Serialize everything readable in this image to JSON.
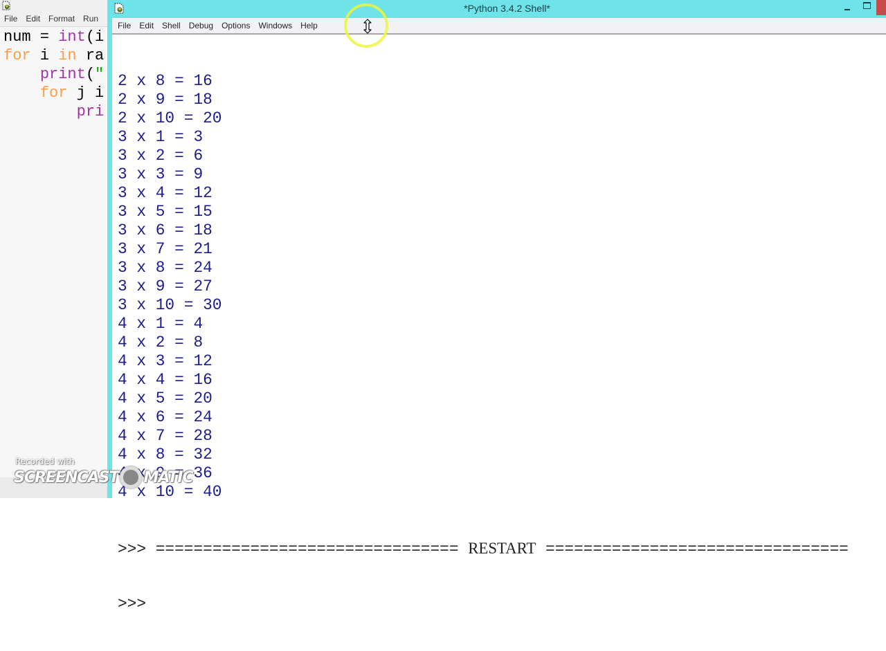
{
  "editor": {
    "menu": [
      "File",
      "Edit",
      "Format",
      "Run"
    ],
    "code_lines": [
      [
        {
          "t": "num = ",
          "c": ""
        },
        {
          "t": "int",
          "c": "bi"
        },
        {
          "t": "(i",
          "c": ""
        }
      ],
      [
        {
          "t": "for",
          "c": "kw"
        },
        {
          "t": " i ",
          "c": ""
        },
        {
          "t": "in",
          "c": "kw"
        },
        {
          "t": " ra",
          "c": ""
        }
      ],
      [
        {
          "t": "    ",
          "c": ""
        },
        {
          "t": "print",
          "c": "bi"
        },
        {
          "t": "(",
          "c": ""
        },
        {
          "t": "\"",
          "c": "str"
        }
      ],
      [
        {
          "t": "    ",
          "c": ""
        },
        {
          "t": "for",
          "c": "kw"
        },
        {
          "t": " j i",
          "c": ""
        }
      ],
      [
        {
          "t": "        ",
          "c": ""
        },
        {
          "t": "pri",
          "c": "bi"
        }
      ]
    ]
  },
  "shell": {
    "title": "*Python 3.4.2 Shell*",
    "menu": [
      "File",
      "Edit",
      "Shell",
      "Debug",
      "Options",
      "Windows",
      "Help"
    ],
    "output_lines": [
      "2 x 8 = 16",
      "2 x 9 = 18",
      "2 x 10 = 20",
      "3 x 1 = 3",
      "3 x 2 = 6",
      "3 x 3 = 9",
      "3 x 4 = 12",
      "3 x 5 = 15",
      "3 x 6 = 18",
      "3 x 7 = 21",
      "3 x 8 = 24",
      "3 x 9 = 27",
      "3 x 10 = 30",
      "4 x 1 = 4",
      "4 x 2 = 8",
      "4 x 3 = 12",
      "4 x 4 = 16",
      "4 x 5 = 20",
      "4 x 6 = 24",
      "4 x 7 = 28",
      "4 x 8 = 32",
      "4 x 9 = 36",
      "4 x 10 = 40"
    ],
    "restart": {
      "prompt": ">>> ",
      "left_rule": "================================",
      "label": "RESTART",
      "right_rule": "================================"
    },
    "prompt": ">>> "
  },
  "watermark": {
    "recorded": "Recorded with",
    "brand_left": "SCREENCAST",
    "brand_right": "MATIC"
  },
  "colors": {
    "titlebar": "#6ee3e8",
    "stdout": "#1c1c8c",
    "close_button": "#c74b4b"
  }
}
